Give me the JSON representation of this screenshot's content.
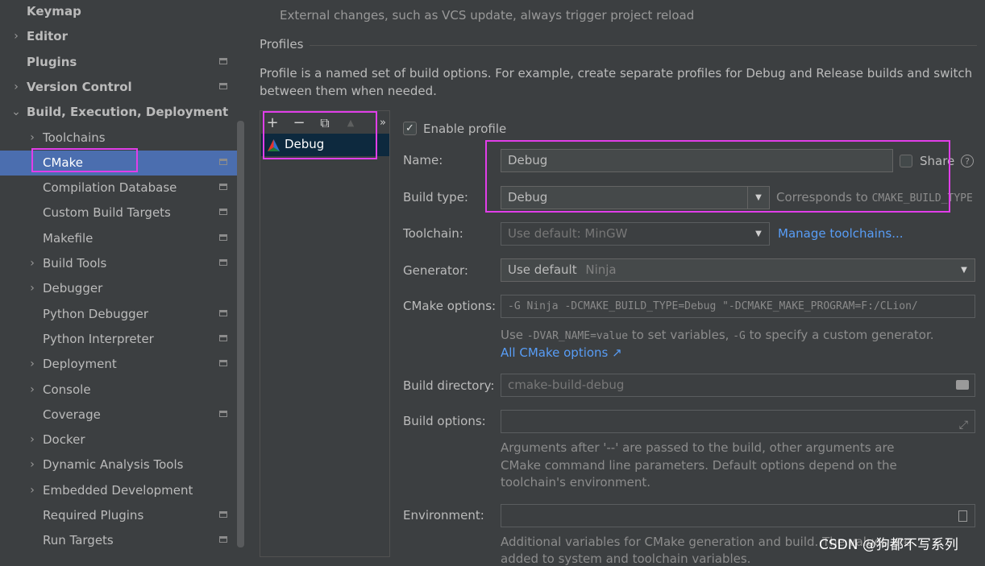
{
  "sidebar": {
    "items": [
      {
        "label": "Keymap",
        "chevron": "",
        "bold": true
      },
      {
        "label": "Editor",
        "chevron": "›",
        "bold": true
      },
      {
        "label": "Plugins",
        "chevron": "",
        "bold": true
      },
      {
        "label": "Version Control",
        "chevron": "›",
        "bold": true
      },
      {
        "label": "Build, Execution, Deployment",
        "chevron": "⌄",
        "bold": true
      },
      {
        "label": "Toolchains",
        "chevron": "›"
      },
      {
        "label": "CMake",
        "chevron": ""
      },
      {
        "label": "Compilation Database",
        "chevron": ""
      },
      {
        "label": "Custom Build Targets",
        "chevron": ""
      },
      {
        "label": "Makefile",
        "chevron": ""
      },
      {
        "label": "Build Tools",
        "chevron": "›"
      },
      {
        "label": "Debugger",
        "chevron": "›"
      },
      {
        "label": "Python Debugger",
        "chevron": ""
      },
      {
        "label": "Python Interpreter",
        "chevron": ""
      },
      {
        "label": "Deployment",
        "chevron": "›"
      },
      {
        "label": "Console",
        "chevron": "›"
      },
      {
        "label": "Coverage",
        "chevron": ""
      },
      {
        "label": "Docker",
        "chevron": "›"
      },
      {
        "label": "Dynamic Analysis Tools",
        "chevron": "›"
      },
      {
        "label": "Embedded Development",
        "chevron": "›"
      },
      {
        "label": "Required Plugins",
        "chevron": ""
      },
      {
        "label": "Run Targets",
        "chevron": ""
      }
    ]
  },
  "main": {
    "top_hint": "External changes, such as VCS update, always trigger project reload",
    "profiles_title": "Profiles",
    "profiles_desc_1": "Profile is a named set of build options. For example, create separate profiles for Debug and Release builds and switch",
    "profiles_desc_2": "between them when needed.",
    "toolbar": {
      "add": "+",
      "remove": "−",
      "copy": "⧉",
      "up": "▲",
      "more": "»"
    },
    "profile_list": [
      "Debug"
    ],
    "enable_profile": "Enable profile",
    "name_label": "Name:",
    "name_value": "Debug",
    "share_label": "Share",
    "help": "?",
    "build_type_label": "Build type:",
    "build_type_value": "Debug",
    "corresponds_prefix": "Corresponds to ",
    "corresponds_code": "CMAKE_BUILD_TYPE",
    "toolchain_label": "Toolchain:",
    "toolchain_value": "Use default: MinGW",
    "manage_toolchains": "Manage toolchains...",
    "generator_label": "Generator:",
    "generator_value": "Use default",
    "generator_hint": "Ninja",
    "cmake_options_label": "CMake options:",
    "cmake_options_value": "-G Ninja -DCMAKE_BUILD_TYPE=Debug \"-DCMAKE_MAKE_PROGRAM=F:/CLion/",
    "use_hint_1": "Use ",
    "use_hint_code1": "-DVAR_NAME=value",
    "use_hint_2": " to set variables, ",
    "use_hint_code2": "-G",
    "use_hint_3": " to specify a custom generator.",
    "all_cmake_options": "All CMake options ↗",
    "build_dir_label": "Build directory:",
    "build_dir_value": "cmake-build-debug",
    "build_options_label": "Build options:",
    "build_options_value": "",
    "build_options_hint_1": "Arguments after '--' are passed to the build, other arguments are",
    "build_options_hint_2": "CMake command line parameters. Default options depend on the",
    "build_options_hint_3": "toolchain's environment.",
    "environment_label": "Environment:",
    "environment_value": "",
    "environment_hint_1": "Additional variables for CMake generation and build. The values are",
    "environment_hint_2": "added to system and toolchain variables."
  },
  "watermark": "CSDN @狗都不写系列"
}
